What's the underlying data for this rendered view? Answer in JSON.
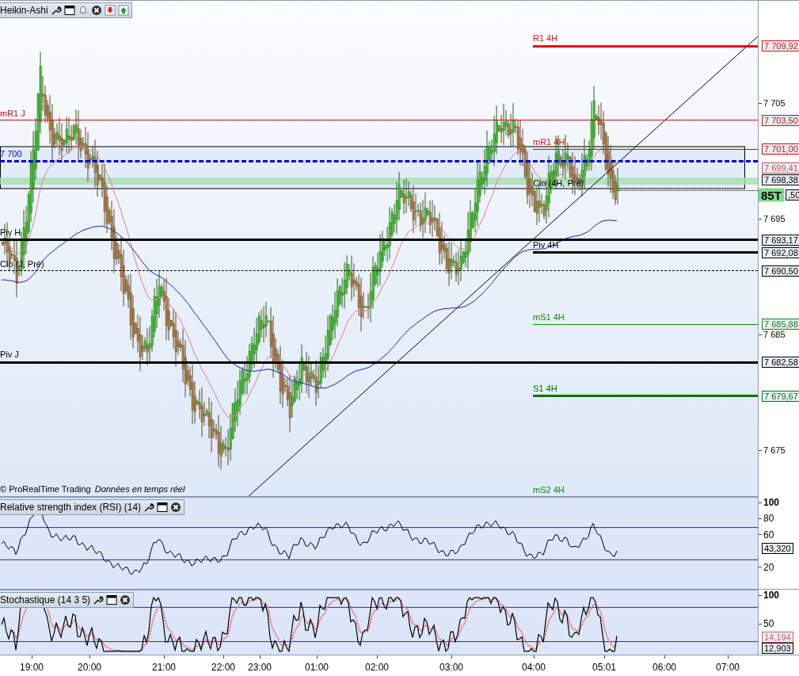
{
  "main_chart": {
    "title": "Heikin-Ashi",
    "levels": [
      {
        "kind": "thick",
        "from_left": false,
        "label": "R1 4H",
        "price": "7 709,92",
        "color": "#e01010"
      },
      {
        "kind": "thin",
        "from_left": true,
        "label": "mR1 J",
        "price": "7 703,50",
        "color": "#cc1010"
      },
      {
        "kind": "thin",
        "from_left": false,
        "label": "mR1 4H",
        "price": "7 701,00",
        "color": "#cc1010"
      },
      {
        "kind": "dashed-bold",
        "from_left": true,
        "label": "7 700",
        "color": "#0000cc"
      },
      {
        "kind": "last",
        "from_left": false,
        "label": "Clo (4H, Pré)",
        "price": ",50",
        "badge": "85T",
        "color": "#000000"
      },
      {
        "kind": "thick",
        "from_left": true,
        "label": "Piv H",
        "price": "7 693,17",
        "color": "#000000"
      },
      {
        "kind": "thick",
        "from_left": false,
        "label": "Piv 4H",
        "price": "7 692,08",
        "color": "#000000"
      },
      {
        "kind": "dashed",
        "from_left": true,
        "label": "Clo (J, Pré)",
        "price": "7 690,50",
        "color": "#000000"
      },
      {
        "kind": "thin",
        "from_left": false,
        "label": "mS1 4H",
        "price": "7 685,88",
        "color": "#118811"
      },
      {
        "kind": "thick",
        "from_left": true,
        "label": "Piv J",
        "price": "7 682,58",
        "color": "#000000"
      },
      {
        "kind": "thick",
        "from_left": false,
        "label": "S1 4H",
        "price": "7 679,67",
        "color": "#007700"
      },
      {
        "kind": "offscreen",
        "from_left": false,
        "label": "mS2 4H",
        "color": "#118811"
      }
    ],
    "indicator_tags": [
      {
        "text": "7 699,41",
        "color": "#c05050"
      },
      {
        "text": "7 698,38",
        "color": "#000000"
      }
    ],
    "ticks": [
      "7 705",
      "7 695",
      "7 685",
      "7 675"
    ],
    "credit": "© ProRealTime Trading",
    "feed": "Données en temps réel"
  },
  "rsi": {
    "title": "Relative strength index (RSI) (14)",
    "ticks": [
      "100",
      "80",
      "60",
      "20"
    ],
    "value": "43,320"
  },
  "stochastic": {
    "title": "Stochastique (14 3 5)",
    "ticks": [
      "100",
      "50"
    ],
    "values": [
      {
        "text": "14,194",
        "color": "#d06060"
      },
      {
        "text": "12,903",
        "color": "#000000"
      }
    ]
  },
  "time_axis": [
    "19:00",
    "20:00",
    "21:00",
    "22:00",
    "23:00",
    "01:00",
    "02:00",
    "03:00",
    "04:00",
    "05:01",
    "06:00",
    "07:00"
  ]
}
